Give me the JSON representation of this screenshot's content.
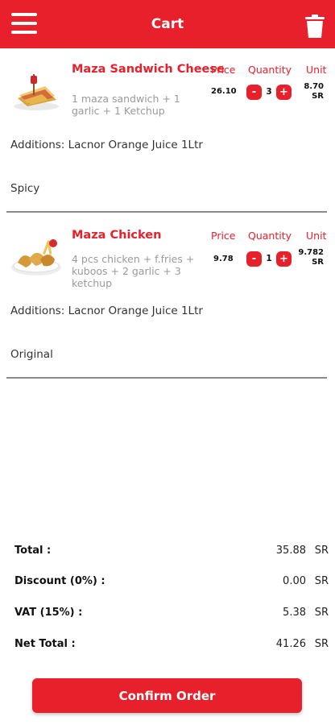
{
  "header": {
    "title": "Cart",
    "menu_icon": "hamburger-menu-icon",
    "trash_icon": "trash-icon"
  },
  "columns": {
    "price": "Price",
    "quantity": "Quantity",
    "unit": "Unit"
  },
  "items": [
    {
      "name": "Maza Sandwich Cheese",
      "description": "1 maza sandwich + 1 garlic + 1 Ketchup",
      "price": "26.10",
      "quantity": "3",
      "unit_value": "8.70",
      "unit_currency": "SR",
      "additions": "Additions: Lacnor Orange Juice 1Ltr",
      "option": "Spicy"
    },
    {
      "name": "Maza Chicken",
      "description": "4 pcs chicken + f.fries + kuboos + 2 garlic + 3 ketchup",
      "price": "9.78",
      "quantity": "1",
      "unit_value": "9.782",
      "unit_currency": "SR",
      "additions": "Additions: Lacnor Orange Juice 1Ltr",
      "option": "Original"
    }
  ],
  "stepper": {
    "minus": "-",
    "plus": "+"
  },
  "totals": {
    "total_label": "Total :",
    "total_value": "35.88",
    "total_currency": "SR",
    "discount_label": "Discount (0%) :",
    "discount_value": "0.00",
    "discount_currency": "SR",
    "vat_label": "VAT (15%) :",
    "vat_value": "5.38",
    "vat_currency": "SR",
    "net_label": "Net Total :",
    "net_value": "41.26",
    "net_currency": "SR"
  },
  "confirm_label": "Confirm Order",
  "colors": {
    "brand": "#e8202b",
    "divider": "#8a8a8a"
  }
}
